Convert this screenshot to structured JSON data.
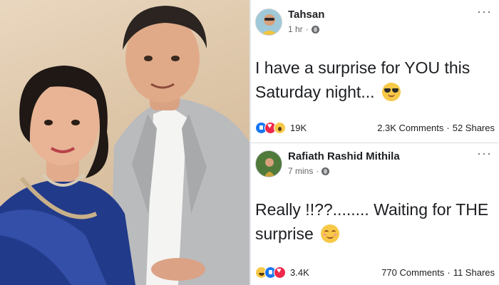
{
  "posts": [
    {
      "author": "Tahsan",
      "time": "1 hr",
      "separator": "·",
      "message": "I have a surprise for YOU this Saturday night...",
      "emoji": "smiling-face-with-sunglasses",
      "reactions": [
        "like",
        "love",
        "wow"
      ],
      "reaction_count": "19K",
      "comments": "2.3K Comments",
      "dot": "·",
      "shares": "52 Shares"
    },
    {
      "author": "Rafiath Rashid Mithila",
      "time": "7 mins",
      "separator": "·",
      "message": "Really !!??........ Waiting for THE surprise",
      "emoji": "smiling-face-with-smiling-eyes",
      "reactions": [
        "haha",
        "like",
        "love"
      ],
      "reaction_count": "3.4K",
      "comments": "770 Comments",
      "dot": "·",
      "shares": "11 Shares"
    }
  ],
  "more_label": "···",
  "colors": {
    "name": "#1c1e21",
    "meta": "#65676b",
    "like": "#1877f2",
    "love": "#f0284a",
    "emoji": "#f7c948"
  }
}
